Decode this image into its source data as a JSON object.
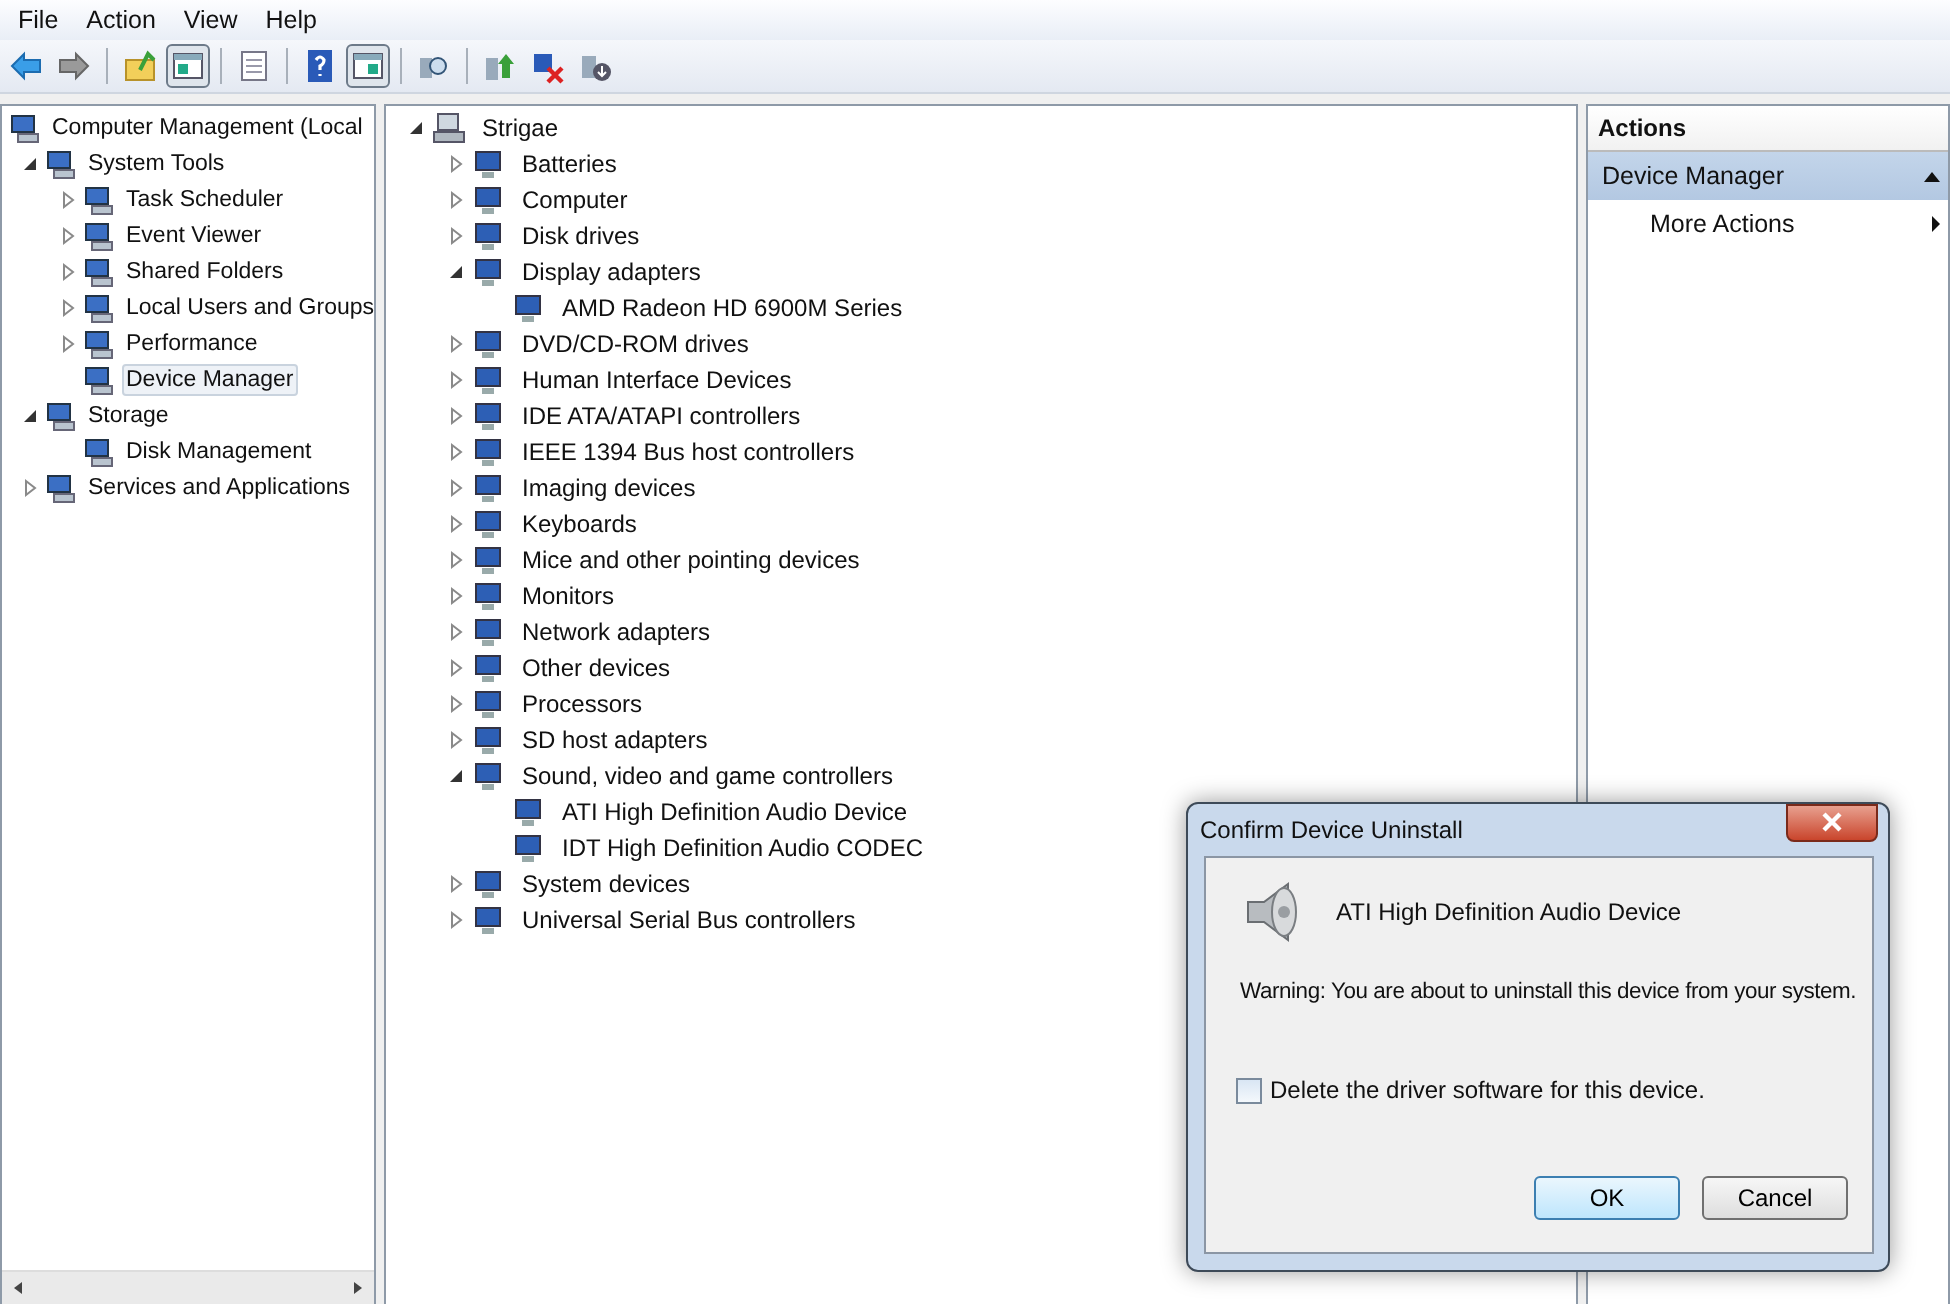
{
  "menu": [
    "File",
    "Action",
    "View",
    "Help"
  ],
  "toolbar": [
    {
      "kind": "back",
      "pressed": false
    },
    {
      "kind": "forward",
      "pressed": false
    },
    {
      "kind": "sep"
    },
    {
      "kind": "up-folder",
      "pressed": false
    },
    {
      "kind": "tree-pane",
      "pressed": true
    },
    {
      "kind": "sep"
    },
    {
      "kind": "list",
      "pressed": false
    },
    {
      "kind": "sep"
    },
    {
      "kind": "help",
      "pressed": false
    },
    {
      "kind": "action-pane",
      "pressed": true
    },
    {
      "kind": "sep"
    },
    {
      "kind": "scan",
      "pressed": false
    },
    {
      "kind": "sep"
    },
    {
      "kind": "update",
      "pressed": false
    },
    {
      "kind": "uninstall",
      "pressed": false
    },
    {
      "kind": "disable",
      "pressed": false
    }
  ],
  "console_tree": [
    {
      "label": "Computer Management (Local",
      "selected": false,
      "children": [
        {
          "label": "System Tools",
          "expanded": true,
          "selected": false,
          "children": [
            {
              "label": "Task Scheduler",
              "expanded": false,
              "selected": false
            },
            {
              "label": "Event Viewer",
              "expanded": false,
              "selected": false
            },
            {
              "label": "Shared Folders",
              "expanded": false,
              "selected": false
            },
            {
              "label": "Local Users and Groups",
              "expanded": false,
              "selected": false
            },
            {
              "label": "Performance",
              "expanded": false,
              "selected": false
            },
            {
              "label": "Device Manager",
              "selected": true
            }
          ]
        },
        {
          "label": "Storage",
          "expanded": true,
          "selected": false,
          "children": [
            {
              "label": "Disk Management",
              "selected": false
            }
          ]
        },
        {
          "label": "Services and Applications",
          "expanded": false,
          "selected": false
        }
      ]
    }
  ],
  "device_tree": [
    {
      "label": "Strigae",
      "expanded": true,
      "children": [
        {
          "label": "Batteries",
          "expanded": false
        },
        {
          "label": "Computer",
          "expanded": false
        },
        {
          "label": "Disk drives",
          "expanded": false
        },
        {
          "label": "Display adapters",
          "expanded": true,
          "children": [
            {
              "label": "AMD Radeon HD 6900M Series"
            }
          ]
        },
        {
          "label": "DVD/CD-ROM drives",
          "expanded": false
        },
        {
          "label": "Human Interface Devices",
          "expanded": false
        },
        {
          "label": "IDE ATA/ATAPI controllers",
          "expanded": false
        },
        {
          "label": "IEEE 1394 Bus host controllers",
          "expanded": false
        },
        {
          "label": "Imaging devices",
          "expanded": false
        },
        {
          "label": "Keyboards",
          "expanded": false
        },
        {
          "label": "Mice and other pointing devices",
          "expanded": false
        },
        {
          "label": "Monitors",
          "expanded": false
        },
        {
          "label": "Network adapters",
          "expanded": false
        },
        {
          "label": "Other devices",
          "expanded": false
        },
        {
          "label": "Processors",
          "expanded": false
        },
        {
          "label": "SD host adapters",
          "expanded": false
        },
        {
          "label": "Sound, video and game controllers",
          "expanded": true,
          "children": [
            {
              "label": "ATI High Definition Audio Device"
            },
            {
              "label": "IDT High Definition Audio CODEC"
            }
          ]
        },
        {
          "label": "System devices",
          "expanded": false
        },
        {
          "label": "Universal Serial Bus controllers",
          "expanded": false
        }
      ]
    }
  ],
  "actions": {
    "title": "Actions",
    "section": {
      "label": "Device Manager",
      "expanded": true
    },
    "items": [
      "More Actions"
    ]
  },
  "dialog": {
    "title": "Confirm Device Uninstall",
    "device": "ATI High Definition Audio Device",
    "warning": "Warning: You are about to uninstall this device from your system.",
    "checkbox": {
      "label": "Delete the driver software for this device.",
      "checked": false
    },
    "buttons": [
      {
        "label": "OK",
        "default": true
      },
      {
        "label": "Cancel",
        "default": false
      }
    ]
  }
}
